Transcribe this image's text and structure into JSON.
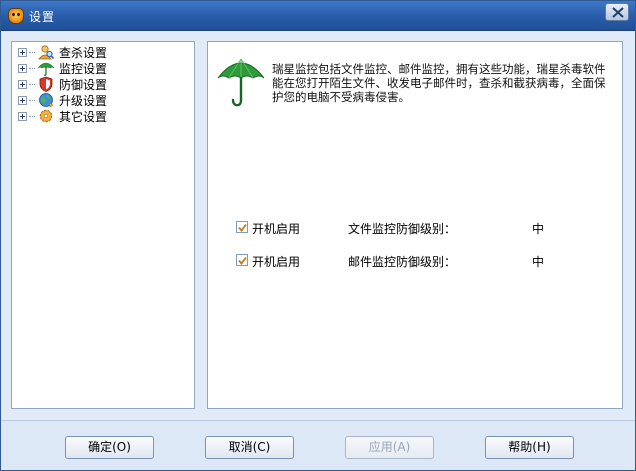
{
  "window": {
    "title": "设置"
  },
  "tree": {
    "items": [
      {
        "label": "查杀设置",
        "icon": "magnifier-person-icon",
        "selected": false
      },
      {
        "label": "监控设置",
        "icon": "umbrella-icon",
        "selected": true
      },
      {
        "label": "防御设置",
        "icon": "shield-icon",
        "selected": false
      },
      {
        "label": "升级设置",
        "icon": "globe-update-icon",
        "selected": false
      },
      {
        "label": "其它设置",
        "icon": "gear-icon",
        "selected": false
      }
    ]
  },
  "content": {
    "description": "瑞星监控包括文件监控、邮件监控，拥有这些功能，瑞星杀毒软件能在您打开陌生文件、收发电子邮件时，查杀和截获病毒，全面保护您的电脑不受病毒侵害。",
    "rows": [
      {
        "checkbox_label": "开机启用",
        "checked": true,
        "level_label": "文件监控防御级别：",
        "level_value": "中"
      },
      {
        "checkbox_label": "开机启用",
        "checked": true,
        "level_label": "邮件监控防御级别：",
        "level_value": "中"
      }
    ]
  },
  "buttons": {
    "ok": "确定(O)",
    "cancel": "取消(C)",
    "apply": "应用(A)",
    "help": "帮助(H)"
  },
  "colors": {
    "titlebar": "#2b60ad",
    "panel_border": "#8fa6c5",
    "umbrella_green": "#2f9a3a"
  }
}
